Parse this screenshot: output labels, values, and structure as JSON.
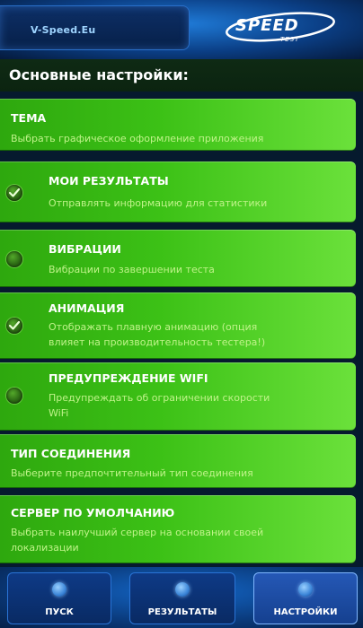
{
  "header": {
    "brand_text": "V-Speed.Eu",
    "logo_main": "SPEED",
    "logo_sub": "TEST"
  },
  "section": {
    "title": "Основные настройки:"
  },
  "settings": [
    {
      "title": "ТЕМА",
      "subtitle": "Выбрать графическое оформление приложения",
      "has_checkbox": false
    },
    {
      "title": "МОИ РЕЗУЛЬТАТЫ",
      "subtitle": "Отправлять информацию для статистики",
      "has_checkbox": true,
      "checked": true
    },
    {
      "title": "ВИБРАЦИИ",
      "subtitle": "Вибрации по завершении теста",
      "has_checkbox": true,
      "checked": false
    },
    {
      "title": "АНИМАЦИЯ",
      "subtitle_line1": "Отображать плавную анимацию (опция",
      "subtitle_line2": "влияет на производительность тестера!)",
      "has_checkbox": true,
      "checked": true
    },
    {
      "title": "ПРЕДУПРЕЖДЕНИЕ WIFI",
      "subtitle_line1": "Предупреждать об ограничении скорости",
      "subtitle_line2": "WiFi",
      "has_checkbox": true,
      "checked": false
    },
    {
      "title": "ТИП СОЕДИНЕНИЯ",
      "subtitle": "Выберите предпочтительный тип соединения",
      "has_checkbox": false
    },
    {
      "title": "СЕРВЕР ПО УМОЛЧАНИЮ",
      "subtitle_line1": "Выбрать наилучший сервер на основании своей",
      "subtitle_line2": "локализации",
      "has_checkbox": false
    }
  ],
  "bottom_nav": [
    {
      "label": "ПУСК",
      "icon": "power-icon",
      "active": false
    },
    {
      "label": "РЕЗУЛЬТАТЫ",
      "icon": "results-icon",
      "active": false
    },
    {
      "label": "НАСТРОЙКИ",
      "icon": "settings-icon",
      "active": true
    }
  ],
  "colors": {
    "row_green": "#3cc116",
    "subtitle_green": "#bff38a",
    "nav_blue": "#0e3a86"
  }
}
